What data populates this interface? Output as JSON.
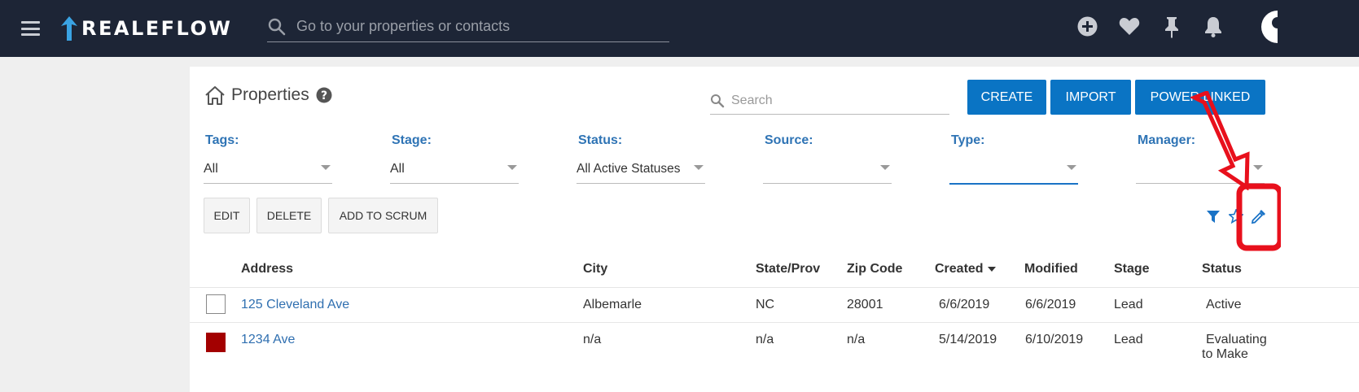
{
  "topbar": {
    "logo_text": "REALEFLOW",
    "search_placeholder": "Go to your properties or contacts",
    "icons": [
      "add-icon",
      "heart-icon",
      "pin-icon",
      "bell-icon",
      "avatar"
    ]
  },
  "page": {
    "title": "Properties",
    "search_placeholder": "Search",
    "buttons": {
      "create": "CREATE",
      "import": "IMPORT",
      "power_linked": "POWER LINKED"
    }
  },
  "filters": [
    {
      "label": "Tags:",
      "value": "All"
    },
    {
      "label": "Stage:",
      "value": "All"
    },
    {
      "label": "Status:",
      "value": "All Active Statuses"
    },
    {
      "label": "Source:",
      "value": ""
    },
    {
      "label": "Type:",
      "value": ""
    },
    {
      "label": "Manager:",
      "value": ""
    }
  ],
  "actions": {
    "edit": "EDIT",
    "delete": "DELETE",
    "add_to_scrum": "ADD TO SCRUM"
  },
  "table": {
    "headers": {
      "address": "Address",
      "city": "City",
      "state": "State/Prov",
      "zip": "Zip Code",
      "created": "Created",
      "modified": "Modified",
      "stage": "Stage",
      "status": "Status"
    },
    "rows": [
      {
        "address": "125 Cleveland Ave",
        "city": "Albemarle",
        "state": "NC",
        "zip": "28001",
        "created": "6/6/2019",
        "modified": "6/6/2019",
        "stage": "Lead",
        "status": "Active",
        "status2": ""
      },
      {
        "address": "1234 Ave",
        "city": "n/a",
        "state": "n/a",
        "zip": "n/a",
        "created": "5/14/2019",
        "modified": "6/10/2019",
        "stage": "Lead",
        "status": "Evaluating",
        "status2": "to Make"
      }
    ]
  },
  "colors": {
    "nav_bg": "#1d2536",
    "primary": "#0a74c4",
    "label_blue": "#2f74b5",
    "annotation_red": "#e8101c"
  }
}
